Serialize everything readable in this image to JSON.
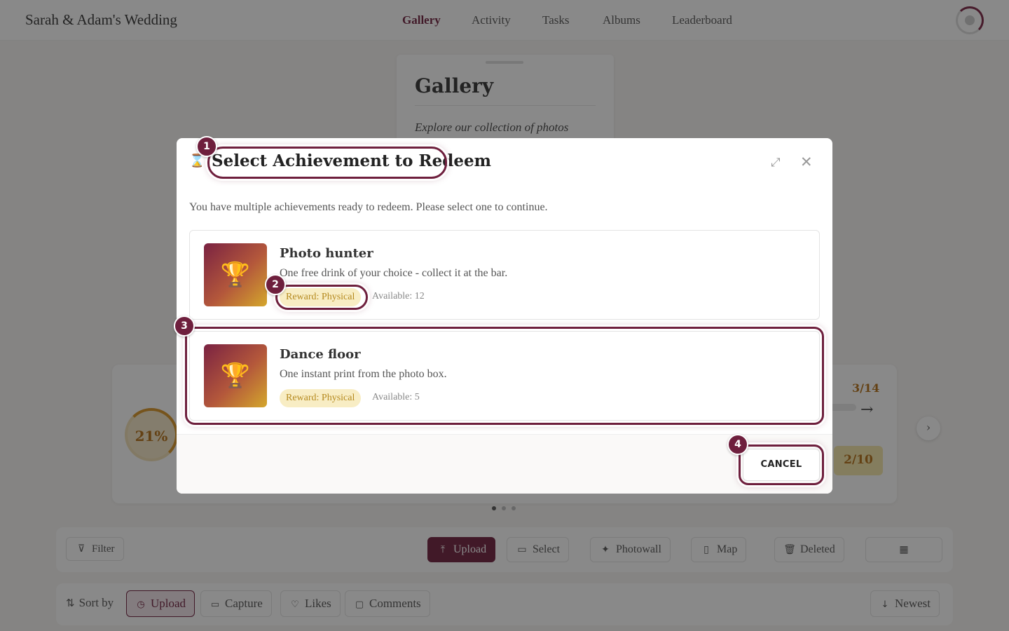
{
  "header": {
    "brand": "Sarah & Adam's Wedding",
    "nav": [
      "Gallery",
      "Activity",
      "Tasks",
      "Albums",
      "Leaderboard"
    ],
    "active_nav": "Gallery"
  },
  "gallery": {
    "title": "Gallery",
    "subtitle": "Explore our collection of photos"
  },
  "progress": {
    "ring_label": "21%",
    "ring_value": 21,
    "count_a": "3/14",
    "count_b": "2/10"
  },
  "toolbar": {
    "filter": "Filter",
    "upload": "Upload",
    "select": "Select",
    "photowall": "Photowall",
    "map": "Map",
    "deleted": "Deleted"
  },
  "sortbar": {
    "label": "Sort by",
    "upload": "Upload",
    "capture": "Capture",
    "likes": "Likes",
    "comments": "Comments",
    "newest": "Newest"
  },
  "modal": {
    "title": "Select Achievement to Redeem",
    "description": "You have multiple achievements ready to redeem. Please select one to continue.",
    "achievements": [
      {
        "name": "Photo hunter",
        "description": "One free drink of your choice - collect it at the bar.",
        "reward": "Reward: Physical",
        "available": "Available: 12"
      },
      {
        "name": "Dance floor",
        "description": "One instant print from the photo box.",
        "reward": "Reward: Physical",
        "available": "Available: 5"
      }
    ],
    "cancel": "CANCEL"
  },
  "annotations": [
    "1",
    "2",
    "3",
    "4"
  ],
  "colors": {
    "accent": "#6e1f3d",
    "gold": "#b46f14",
    "reward_bg": "#f8edc4"
  }
}
